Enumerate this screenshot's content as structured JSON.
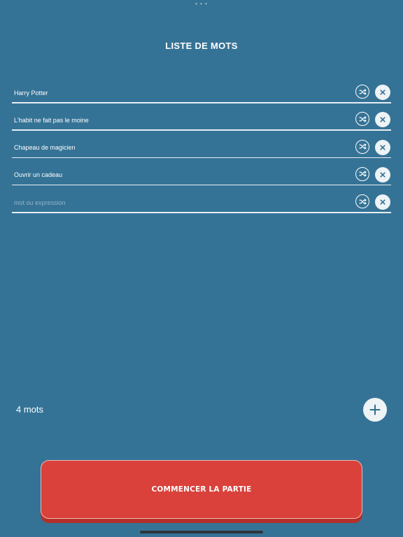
{
  "header": {
    "title": "LISTE DE MOTS"
  },
  "words": [
    {
      "value": "Harry Potter",
      "placeholder": ""
    },
    {
      "value": "L'habit ne fait pas le moine",
      "placeholder": ""
    },
    {
      "value": "Chapeau de magicien",
      "placeholder": ""
    },
    {
      "value": "Ouvrir un cadeau",
      "placeholder": ""
    },
    {
      "value": "",
      "placeholder": "mot ou expression"
    }
  ],
  "footer": {
    "count_label": "4 mots",
    "start_label": "COMMENCER LA PARTIE"
  },
  "icons": {
    "shuffle": "shuffle-icon",
    "delete": "close-icon",
    "add": "plus-icon"
  },
  "colors": {
    "background": "#357396",
    "start_button": "#d9413a",
    "icon_color": "#2f6e90"
  }
}
